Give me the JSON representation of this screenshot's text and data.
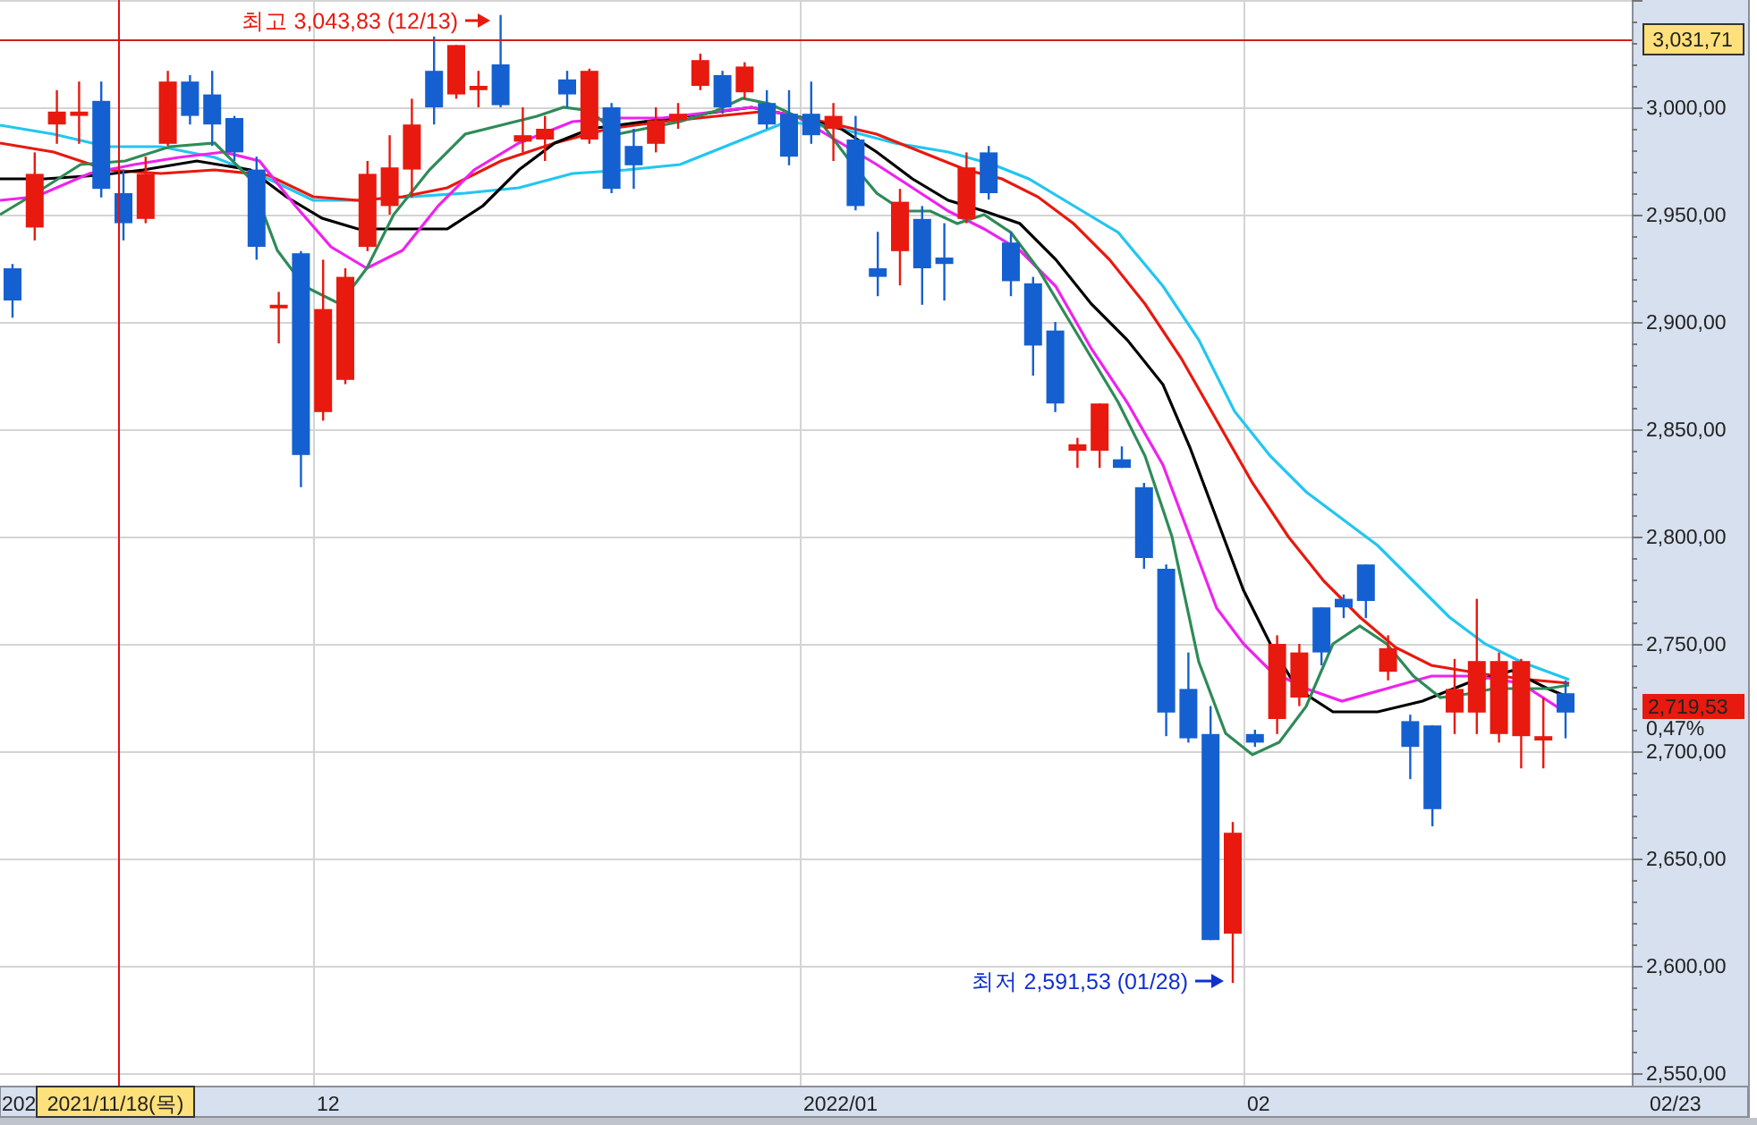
{
  "price_chart": {
    "y_axis_labels": [
      "3,000,00",
      "2,950,00",
      "2,900,00",
      "2,850,00",
      "2,800,00",
      "2,750,00",
      "2,700,00",
      "2,650,00",
      "2,600,00",
      "2,550,00"
    ],
    "x_axis_labels": [
      "202",
      "12",
      "2022/01",
      "02"
    ],
    "high_note": "최고 3,043,83 (12/13)",
    "low_note": "최저 2,591,53 (01/28)",
    "crosshair_date": "2021/11/18(목)",
    "crosshair_price": "3,031,71",
    "last_price": "2,719,53",
    "change": "0,47%",
    "last_date": "02/23"
  }
}
